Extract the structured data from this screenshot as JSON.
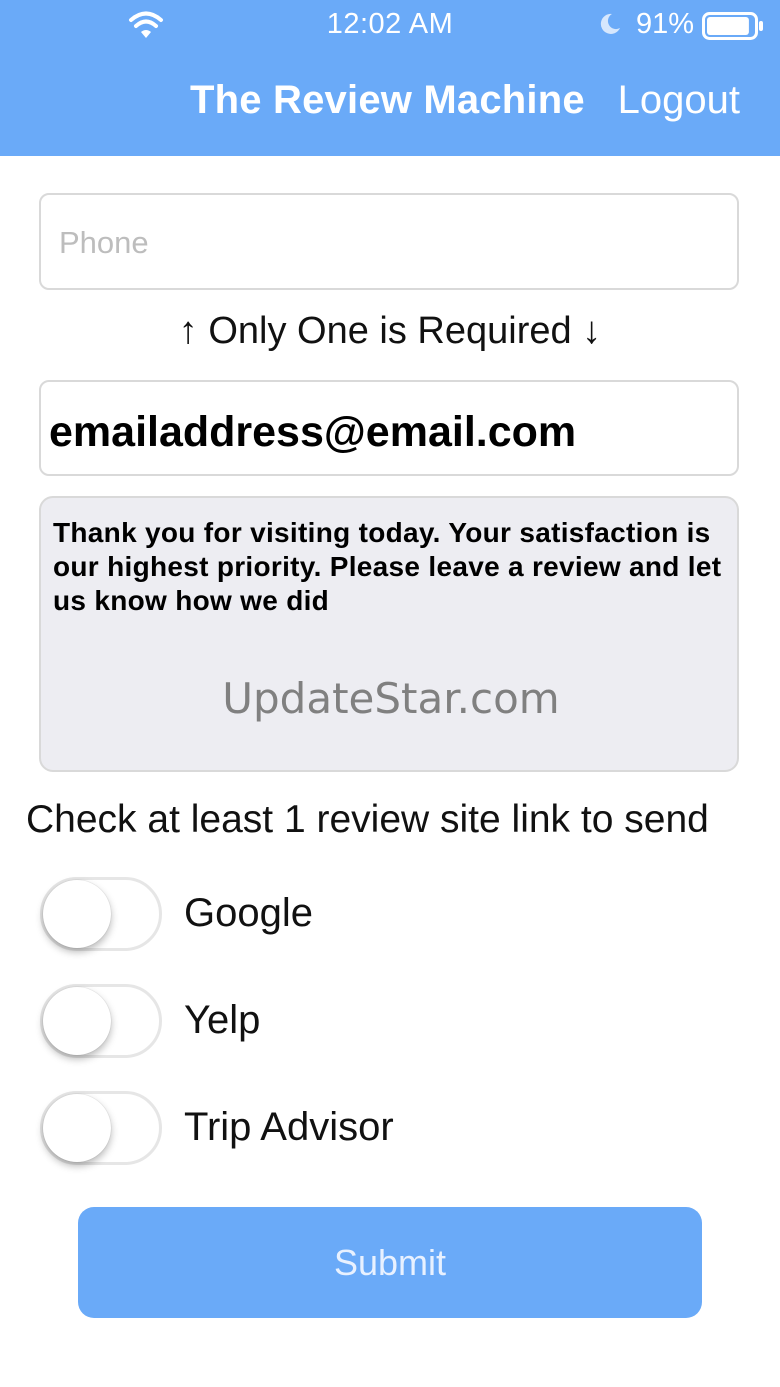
{
  "status_bar": {
    "time": "12:02 AM",
    "battery_percent": "91%",
    "battery_level": 0.91,
    "icons": [
      "wifi-icon",
      "moon-icon",
      "battery-icon"
    ]
  },
  "nav": {
    "title": "The Review Machine",
    "logout_label": "Logout"
  },
  "form": {
    "phone_placeholder": "Phone",
    "phone_value": "",
    "required_note": "↑ Only One is Required ↓",
    "email_value": "emailaddress@email.com",
    "message_text": "Thank you for visiting today. Your satisfaction is our highest priority. Please leave a review and let us know how we did",
    "watermark": "UpdateStar.com",
    "check_label": "Check at least 1 review site link to send",
    "sites": [
      {
        "label": "Google",
        "checked": false
      },
      {
        "label": "Yelp",
        "checked": false
      },
      {
        "label": "Trip Advisor",
        "checked": false
      }
    ],
    "submit_label": "Submit"
  },
  "colors": {
    "accent": "#6aaaf8",
    "background": "#ffffff",
    "message_background": "#ededf2"
  }
}
